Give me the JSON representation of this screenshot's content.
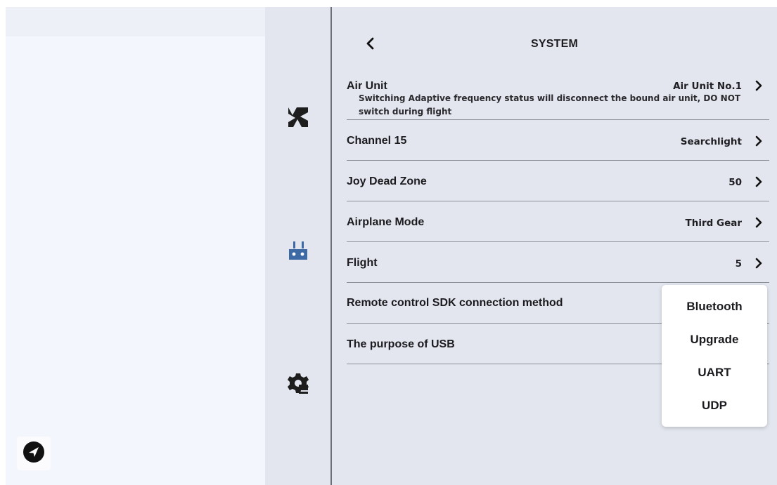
{
  "header": {
    "title": "SYSTEM"
  },
  "icons": {
    "back": "chevron-left-icon",
    "nav": "navigation-arrow-icon",
    "rail": [
      "camera-aperture-icon",
      "remote-controller-icon",
      "settings-gear-icon"
    ]
  },
  "settings": [
    {
      "label": "Air Unit",
      "value": "Air Unit No.1",
      "description": "Switching Adaptive frequency status will disconnect the bound air unit, DO NOT switch during flight"
    },
    {
      "label": "Channel 15",
      "value": "Searchlight"
    },
    {
      "label": "Joy Dead Zone",
      "value": "50"
    },
    {
      "label": "Airplane Mode",
      "value": "Third Gear"
    },
    {
      "label": "Flight",
      "value": "5"
    },
    {
      "label": "Remote control SDK connection method"
    },
    {
      "label": "The purpose of USB"
    }
  ],
  "dropdown": {
    "options": [
      "Bluetooth",
      "Upgrade",
      "UART",
      "UDP"
    ]
  },
  "colors": {
    "main_bg": "#e3e6ee",
    "left_bg": "#f4f6fd",
    "rail_accent": "#3d6aa4",
    "divider": "#8c8f96"
  }
}
